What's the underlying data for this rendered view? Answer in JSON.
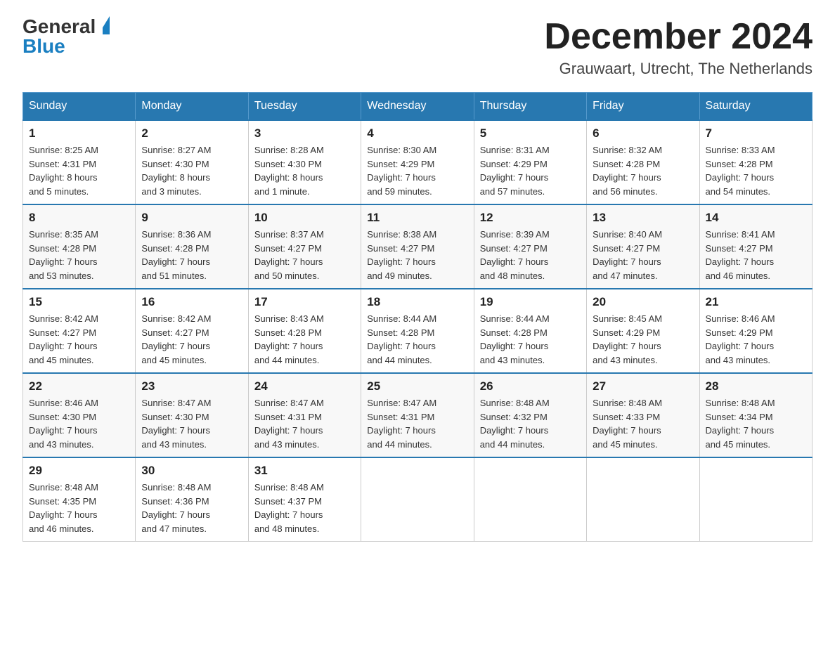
{
  "header": {
    "logo_general": "General",
    "logo_blue": "Blue",
    "month_title": "December 2024",
    "location": "Grauwaart, Utrecht, The Netherlands"
  },
  "weekdays": [
    "Sunday",
    "Monday",
    "Tuesday",
    "Wednesday",
    "Thursday",
    "Friday",
    "Saturday"
  ],
  "weeks": [
    [
      {
        "day": "1",
        "sunrise": "8:25 AM",
        "sunset": "4:31 PM",
        "daylight": "8 hours and 5 minutes."
      },
      {
        "day": "2",
        "sunrise": "8:27 AM",
        "sunset": "4:30 PM",
        "daylight": "8 hours and 3 minutes."
      },
      {
        "day": "3",
        "sunrise": "8:28 AM",
        "sunset": "4:30 PM",
        "daylight": "8 hours and 1 minute."
      },
      {
        "day": "4",
        "sunrise": "8:30 AM",
        "sunset": "4:29 PM",
        "daylight": "7 hours and 59 minutes."
      },
      {
        "day": "5",
        "sunrise": "8:31 AM",
        "sunset": "4:29 PM",
        "daylight": "7 hours and 57 minutes."
      },
      {
        "day": "6",
        "sunrise": "8:32 AM",
        "sunset": "4:28 PM",
        "daylight": "7 hours and 56 minutes."
      },
      {
        "day": "7",
        "sunrise": "8:33 AM",
        "sunset": "4:28 PM",
        "daylight": "7 hours and 54 minutes."
      }
    ],
    [
      {
        "day": "8",
        "sunrise": "8:35 AM",
        "sunset": "4:28 PM",
        "daylight": "7 hours and 53 minutes."
      },
      {
        "day": "9",
        "sunrise": "8:36 AM",
        "sunset": "4:28 PM",
        "daylight": "7 hours and 51 minutes."
      },
      {
        "day": "10",
        "sunrise": "8:37 AM",
        "sunset": "4:27 PM",
        "daylight": "7 hours and 50 minutes."
      },
      {
        "day": "11",
        "sunrise": "8:38 AM",
        "sunset": "4:27 PM",
        "daylight": "7 hours and 49 minutes."
      },
      {
        "day": "12",
        "sunrise": "8:39 AM",
        "sunset": "4:27 PM",
        "daylight": "7 hours and 48 minutes."
      },
      {
        "day": "13",
        "sunrise": "8:40 AM",
        "sunset": "4:27 PM",
        "daylight": "7 hours and 47 minutes."
      },
      {
        "day": "14",
        "sunrise": "8:41 AM",
        "sunset": "4:27 PM",
        "daylight": "7 hours and 46 minutes."
      }
    ],
    [
      {
        "day": "15",
        "sunrise": "8:42 AM",
        "sunset": "4:27 PM",
        "daylight": "7 hours and 45 minutes."
      },
      {
        "day": "16",
        "sunrise": "8:42 AM",
        "sunset": "4:27 PM",
        "daylight": "7 hours and 45 minutes."
      },
      {
        "day": "17",
        "sunrise": "8:43 AM",
        "sunset": "4:28 PM",
        "daylight": "7 hours and 44 minutes."
      },
      {
        "day": "18",
        "sunrise": "8:44 AM",
        "sunset": "4:28 PM",
        "daylight": "7 hours and 44 minutes."
      },
      {
        "day": "19",
        "sunrise": "8:44 AM",
        "sunset": "4:28 PM",
        "daylight": "7 hours and 43 minutes."
      },
      {
        "day": "20",
        "sunrise": "8:45 AM",
        "sunset": "4:29 PM",
        "daylight": "7 hours and 43 minutes."
      },
      {
        "day": "21",
        "sunrise": "8:46 AM",
        "sunset": "4:29 PM",
        "daylight": "7 hours and 43 minutes."
      }
    ],
    [
      {
        "day": "22",
        "sunrise": "8:46 AM",
        "sunset": "4:30 PM",
        "daylight": "7 hours and 43 minutes."
      },
      {
        "day": "23",
        "sunrise": "8:47 AM",
        "sunset": "4:30 PM",
        "daylight": "7 hours and 43 minutes."
      },
      {
        "day": "24",
        "sunrise": "8:47 AM",
        "sunset": "4:31 PM",
        "daylight": "7 hours and 43 minutes."
      },
      {
        "day": "25",
        "sunrise": "8:47 AM",
        "sunset": "4:31 PM",
        "daylight": "7 hours and 44 minutes."
      },
      {
        "day": "26",
        "sunrise": "8:48 AM",
        "sunset": "4:32 PM",
        "daylight": "7 hours and 44 minutes."
      },
      {
        "day": "27",
        "sunrise": "8:48 AM",
        "sunset": "4:33 PM",
        "daylight": "7 hours and 45 minutes."
      },
      {
        "day": "28",
        "sunrise": "8:48 AM",
        "sunset": "4:34 PM",
        "daylight": "7 hours and 45 minutes."
      }
    ],
    [
      {
        "day": "29",
        "sunrise": "8:48 AM",
        "sunset": "4:35 PM",
        "daylight": "7 hours and 46 minutes."
      },
      {
        "day": "30",
        "sunrise": "8:48 AM",
        "sunset": "4:36 PM",
        "daylight": "7 hours and 47 minutes."
      },
      {
        "day": "31",
        "sunrise": "8:48 AM",
        "sunset": "4:37 PM",
        "daylight": "7 hours and 48 minutes."
      },
      null,
      null,
      null,
      null
    ]
  ],
  "labels": {
    "sunrise": "Sunrise:",
    "sunset": "Sunset:",
    "daylight": "Daylight:"
  }
}
